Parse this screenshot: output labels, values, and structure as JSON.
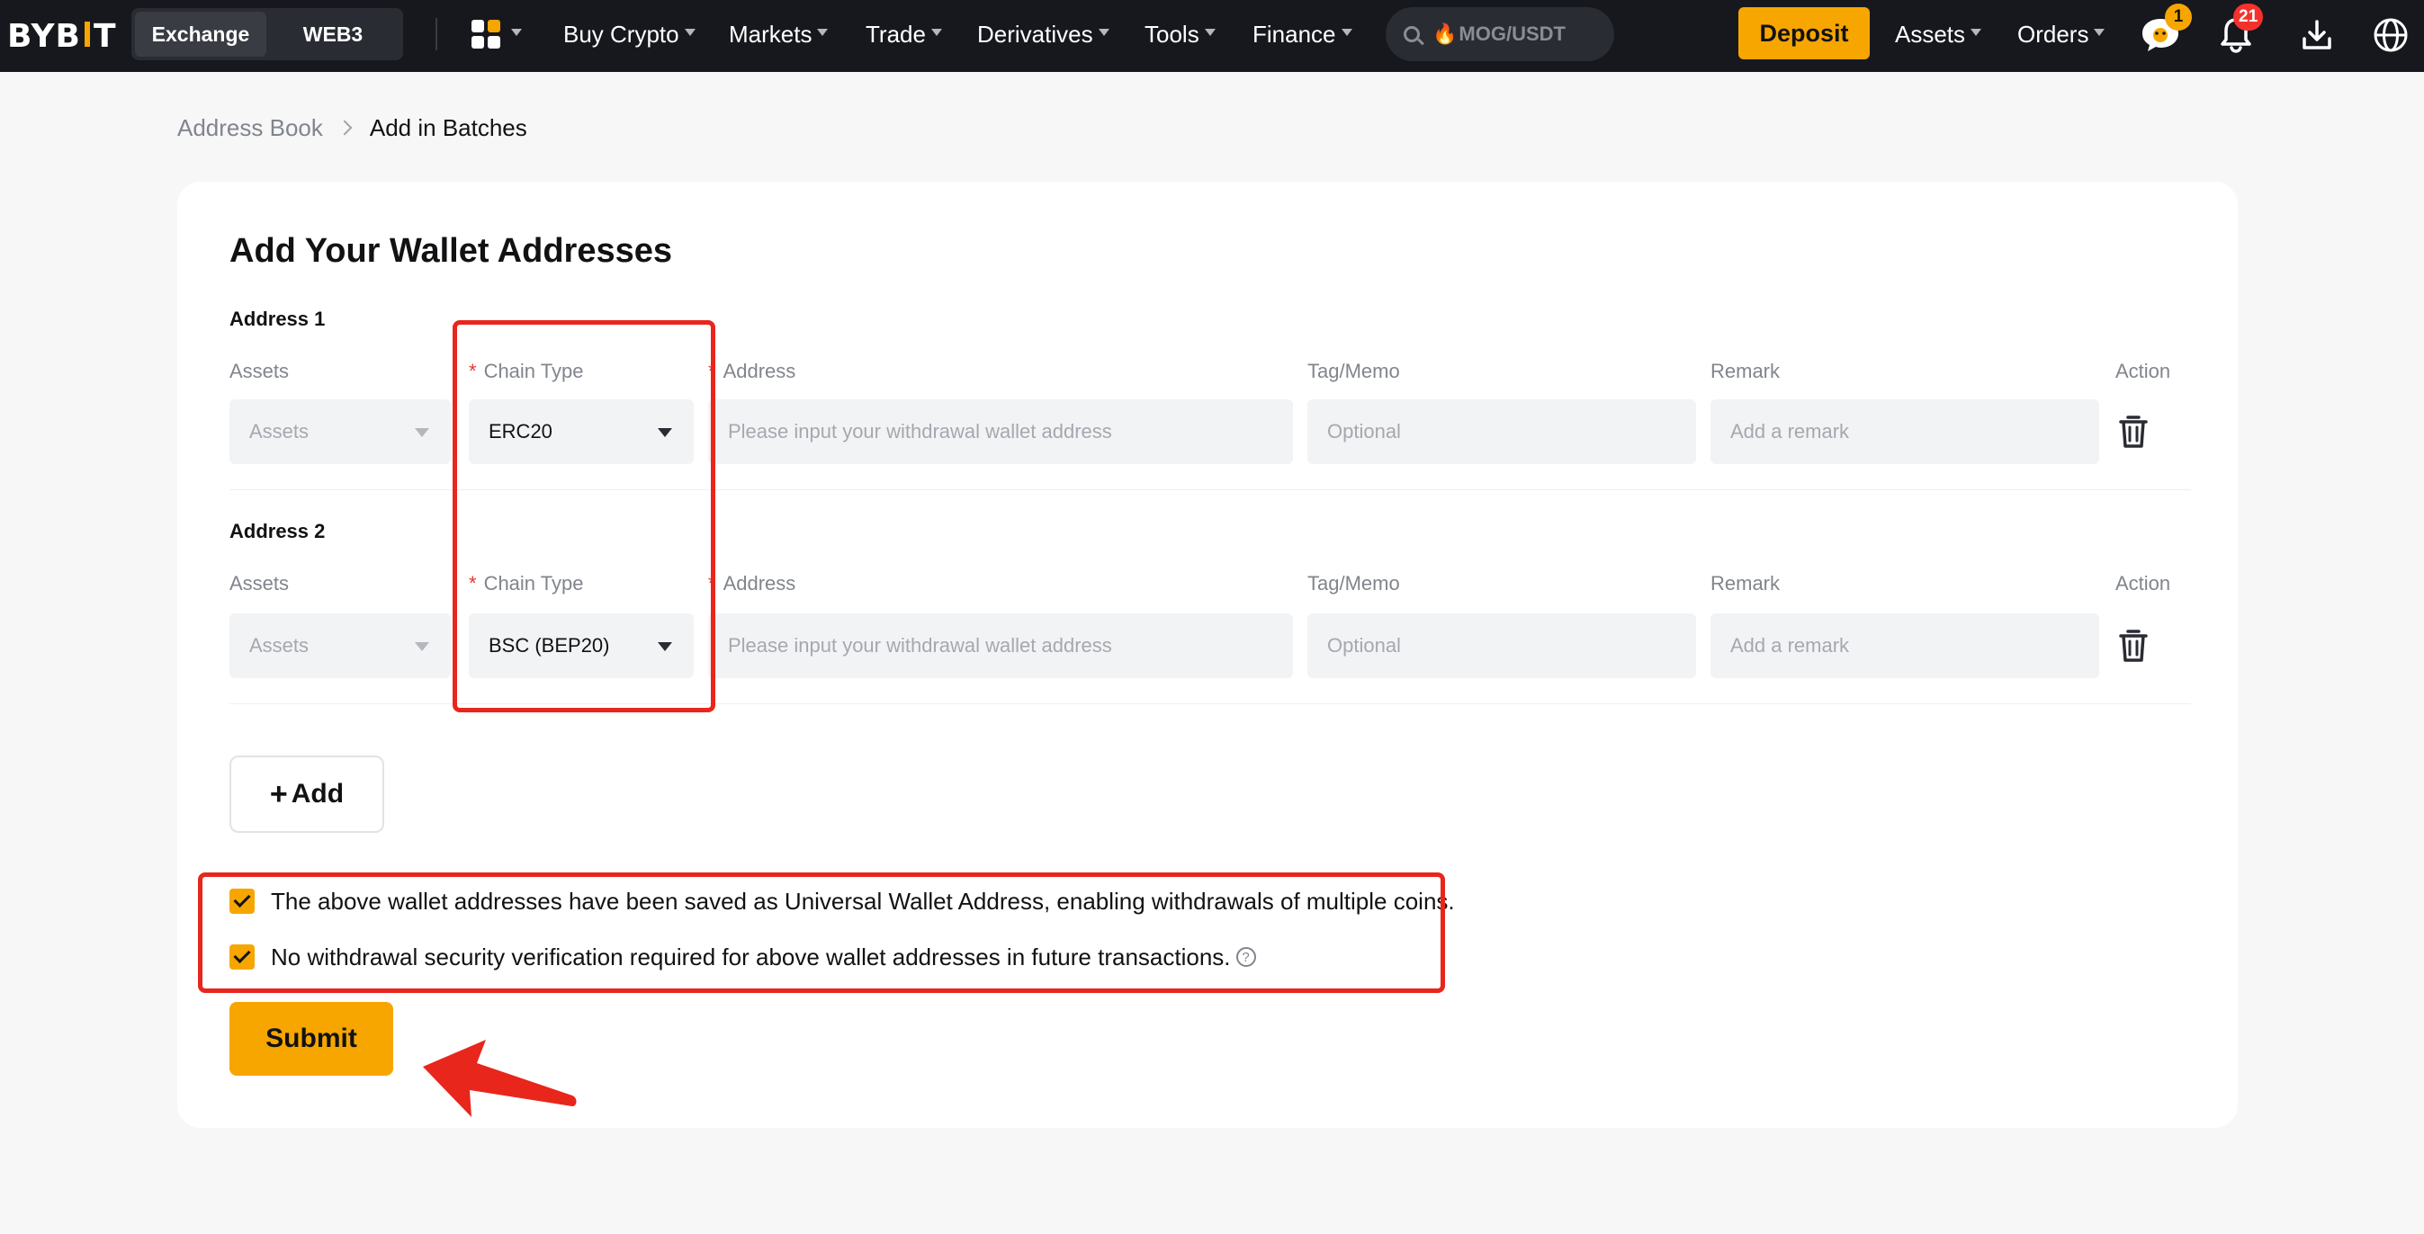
{
  "colors": {
    "nav_bg": "#17181e",
    "accent": "#f7a600",
    "badge_red": "#f5312e",
    "required_red": "#e53935",
    "annotation_red": "#e8261c"
  },
  "nav": {
    "logo": "BYBIT",
    "tabs": [
      {
        "label": "Exchange",
        "active": true
      },
      {
        "label": "WEB3",
        "active": false
      }
    ],
    "apps_icon": "apps-grid-icon",
    "menu": [
      "Buy Crypto",
      "Markets",
      "Trade",
      "Derivatives",
      "Tools",
      "Finance"
    ],
    "search_placeholder": "MOG/USDT",
    "deposit_label": "Deposit",
    "assets_label": "Assets",
    "orders_label": "Orders",
    "chat_badge": "1",
    "notification_badge": "21",
    "icons": [
      "search-icon",
      "fire-icon",
      "chat-icon",
      "bell-icon",
      "download-icon",
      "globe-icon"
    ]
  },
  "breadcrumb": {
    "parent": "Address Book",
    "current": "Add in Batches"
  },
  "form": {
    "title": "Add Your Wallet Addresses",
    "columns": {
      "assets": "Assets",
      "chain_type": "Chain Type",
      "address": "Address",
      "tag": "Tag/Memo",
      "remark": "Remark",
      "action": "Action"
    },
    "required_mark": "*",
    "rows": [
      {
        "title": "Address 1",
        "assets_placeholder": "Assets",
        "chain_value": "ERC20",
        "address_placeholder": "Please input your withdrawal wallet address",
        "tag_placeholder": "Optional",
        "remark_placeholder": "Add a remark"
      },
      {
        "title": "Address 2",
        "assets_placeholder": "Assets",
        "chain_value": "BSC (BEP20)",
        "address_placeholder": "Please input your withdrawal wallet address",
        "tag_placeholder": "Optional",
        "remark_placeholder": "Add a remark"
      }
    ],
    "add_label": "Add",
    "checkboxes": [
      {
        "label": "The above wallet addresses have been saved as Universal Wallet Address, enabling withdrawals of multiple coins.",
        "checked": true
      },
      {
        "label": "No withdrawal security verification required for above wallet addresses in future transactions.",
        "checked": true,
        "help_icon": "?"
      }
    ],
    "submit_label": "Submit"
  }
}
